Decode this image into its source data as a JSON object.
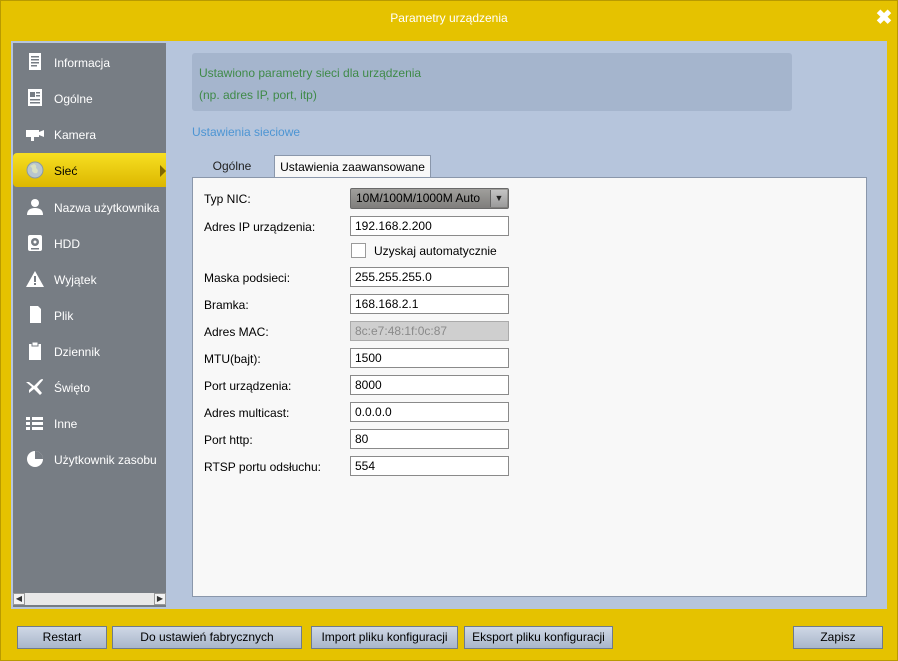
{
  "window": {
    "title": "Parametry urządzenia",
    "close_icon": "close-icon"
  },
  "sidebar": {
    "items": [
      {
        "label": "Informacja",
        "icon": "document-icon"
      },
      {
        "label": "Ogólne",
        "icon": "general-icon"
      },
      {
        "label": "Kamera",
        "icon": "camera-icon"
      },
      {
        "label": "Sieć",
        "icon": "globe-icon",
        "active": true
      },
      {
        "label": "Nazwa użytkownika",
        "icon": "user-icon"
      },
      {
        "label": "HDD",
        "icon": "hdd-icon"
      },
      {
        "label": "Wyjątek",
        "icon": "warning-icon"
      },
      {
        "label": "Plik",
        "icon": "file-icon"
      },
      {
        "label": "Dziennik",
        "icon": "clipboard-icon"
      },
      {
        "label": "Święto",
        "icon": "airplane-icon"
      },
      {
        "label": "Inne",
        "icon": "list-icon"
      },
      {
        "label": "Użytkownik zasobu",
        "icon": "pie-icon"
      }
    ]
  },
  "info": {
    "line1": "Ustawiono parametry sieci dla urządzenia",
    "line2": "(np. adres IP, port, itp)"
  },
  "section_title": "Ustawienia sieciowe",
  "tabs": {
    "general": "Ogólne",
    "advanced": "Ustawienia zaawansowane"
  },
  "form": {
    "nic_type": {
      "label": "Typ NIC:",
      "value": "10M/100M/1000M Auto"
    },
    "ip": {
      "label": "Adres IP urządzenia:",
      "value": "192.168.2.200"
    },
    "auto_obtain": {
      "label": "Uzyskaj automatycznie",
      "checked": false
    },
    "subnet": {
      "label": "Maska podsieci:",
      "value": "255.255.255.0"
    },
    "gateway": {
      "label": "Bramka:",
      "value": "168.168.2.1"
    },
    "mac": {
      "label": "Adres MAC:",
      "value": "8c:e7:48:1f:0c:87"
    },
    "mtu": {
      "label": "MTU(bajt):",
      "value": "1500"
    },
    "device_port": {
      "label": "Port urządzenia:",
      "value": "8000"
    },
    "multicast": {
      "label": "Adres multicast:",
      "value": "0.0.0.0"
    },
    "http_port": {
      "label": "Port http:",
      "value": "80"
    },
    "rtsp_port": {
      "label": "RTSP portu odsłuchu:",
      "value": "554"
    }
  },
  "buttons": {
    "restart": "Restart",
    "factory": "Do ustawień fabrycznych",
    "import": "Import pliku konfiguracji",
    "export": "Eksport pliku konfiguracji",
    "save": "Zapisz"
  },
  "colors": {
    "frame": "#e5c200",
    "panel": "#b6c5dc",
    "sidebar": "#777d84",
    "active": "#f0d214",
    "info_text": "#3f8a48",
    "section_title": "#4d95d3"
  }
}
